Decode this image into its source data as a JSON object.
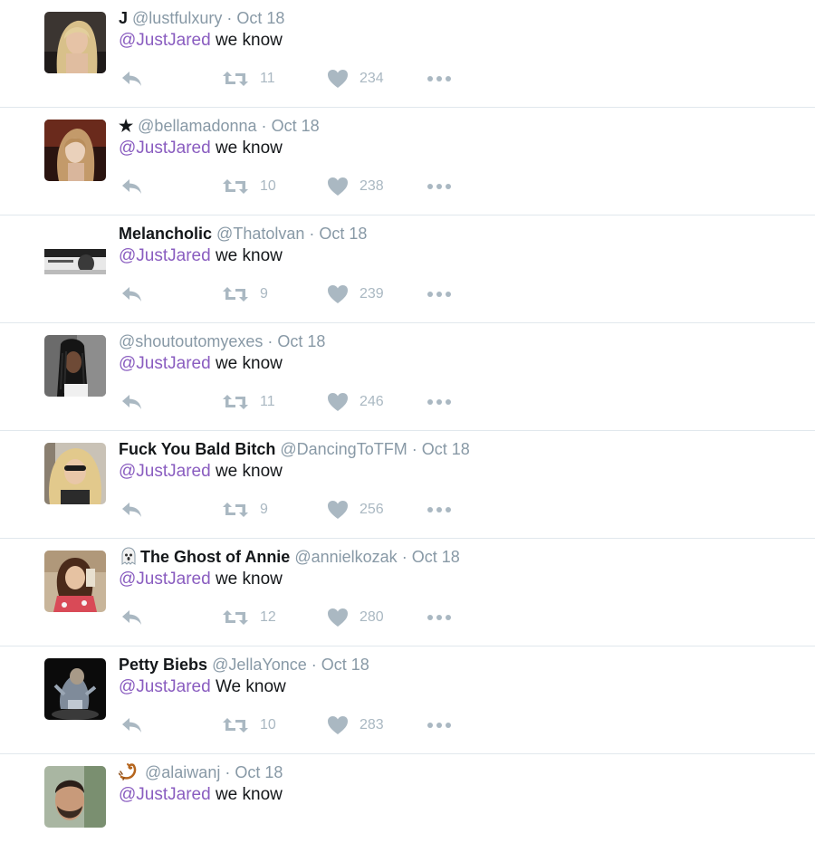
{
  "colors": {
    "mention": "#8a5dc0",
    "meta": "#8899a6",
    "action_icon": "#aab8c2",
    "divider": "#e1e8ed"
  },
  "tweets": [
    {
      "name": "J",
      "emoji": "",
      "handle": "@lustfulxury",
      "separator": "·",
      "time": "Oct 18",
      "mention": "@JustJared",
      "body": " we know",
      "retweets": "11",
      "likes": "234",
      "avatar_icon": "blonde-woman-photo"
    },
    {
      "name": "★",
      "emoji": "",
      "handle": "@bellamadonna",
      "separator": "·",
      "time": "Oct 18",
      "mention": "@JustJared",
      "body": " we know",
      "retweets": "10",
      "likes": "238",
      "avatar_icon": "woman-portrait-photo"
    },
    {
      "name": "Melancholic",
      "emoji": "",
      "handle": "@Thatolvan",
      "separator": "·",
      "time": "Oct 18",
      "mention": "@JustJared",
      "body": " we know",
      "retweets": "9",
      "likes": "239",
      "avatar_icon": "black-and-white-banner-photo"
    },
    {
      "name": "",
      "emoji": "",
      "handle": "@shoutoutomyexes",
      "separator": "·",
      "time": "Oct 18",
      "mention": "@JustJared",
      "body": " we know",
      "retweets": "11",
      "likes": "246",
      "avatar_icon": "braided-hair-woman-photo"
    },
    {
      "name": "Fuck You Bald Bitch",
      "emoji": "",
      "handle": "@DancingToTFM",
      "separator": "·",
      "time": "Oct 18",
      "mention": "@JustJared",
      "body": " we know",
      "retweets": "9",
      "likes": "256",
      "avatar_icon": "curly-blonde-woman-photo"
    },
    {
      "name": "The Ghost of Annie",
      "emoji": "ghost",
      "handle": "@annielkozak",
      "separator": "·",
      "time": "Oct 18",
      "mention": "@JustJared",
      "body": " we know",
      "retweets": "12",
      "likes": "280",
      "avatar_icon": "selfie-woman-photo"
    },
    {
      "name": "Petty Biebs",
      "emoji": "",
      "handle": "@JellaYonce",
      "separator": "·",
      "time": "Oct 18",
      "mention": "@JustJared",
      "body": " We know",
      "retweets": "10",
      "likes": "283",
      "avatar_icon": "performer-photo"
    },
    {
      "name": "",
      "emoji": "scorpion",
      "handle": "@alaiwanj",
      "separator": "·",
      "time": "Oct 18",
      "mention": "@JustJared",
      "body": " we know",
      "retweets": "",
      "likes": "",
      "avatar_icon": "bearded-man-photo"
    }
  ]
}
